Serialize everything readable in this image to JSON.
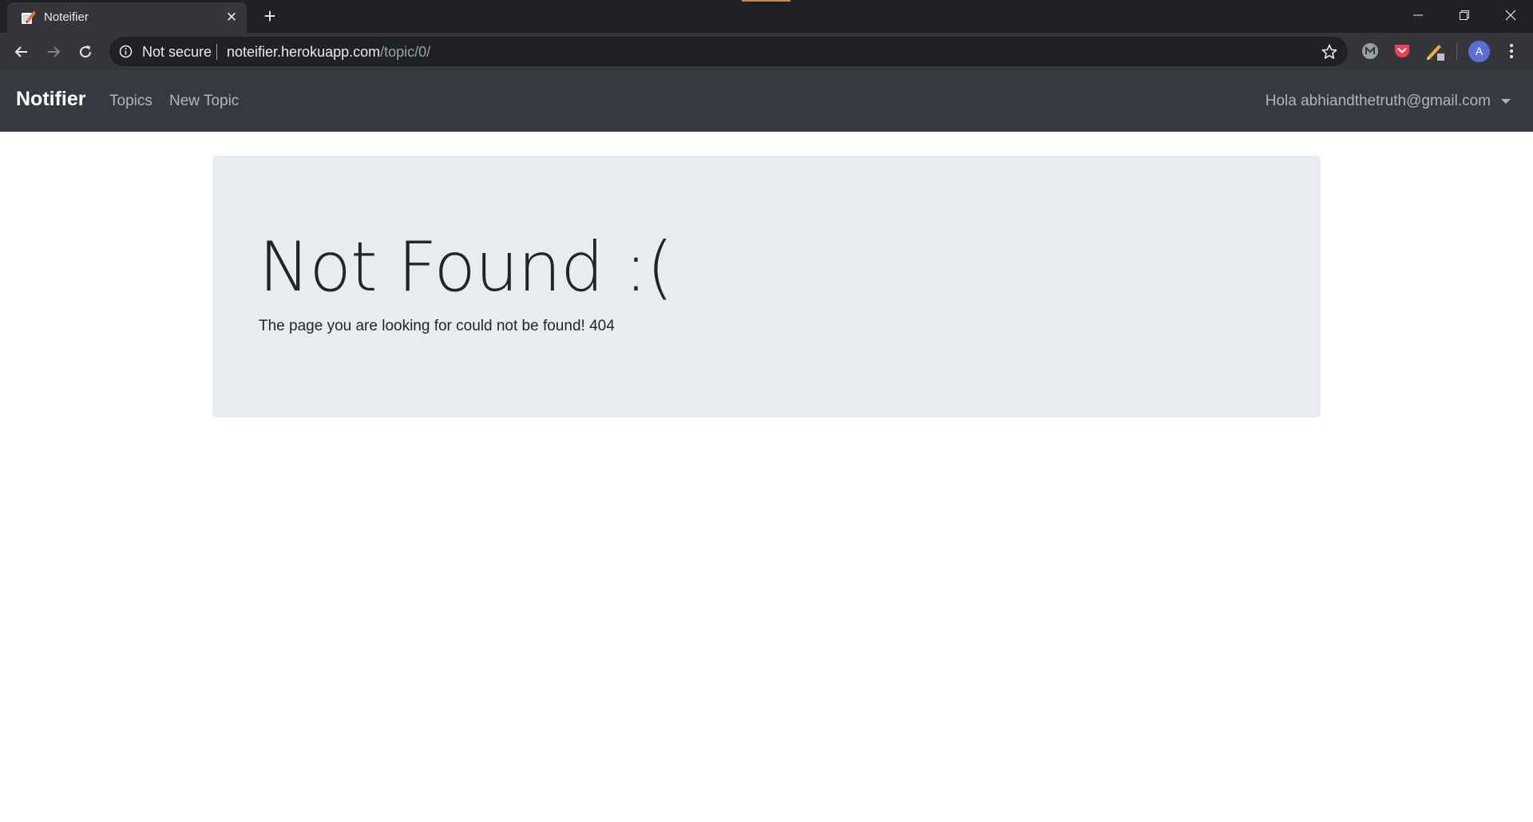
{
  "browser": {
    "tab": {
      "title": "Noteifier",
      "favicon": "notepad-pen-icon"
    },
    "address_bar": {
      "security_label": "Not secure",
      "url_host": "noteifier.herokuapp.com",
      "url_path": "/topic/0/"
    },
    "extension_icons": [
      "m-extension-icon",
      "pocket-icon",
      "pen-extension-icon"
    ],
    "profile_initial": "A",
    "colors": {
      "tabstrip": "#202124",
      "toolbar": "#35363a",
      "avatar": "#5b6fd6",
      "pocket": "#ef4056"
    }
  },
  "navbar": {
    "brand": "Notifier",
    "links": [
      "Topics",
      "New Topic"
    ],
    "user_menu": "Hola abhiandthetruth@gmail.com",
    "background": "#343a40"
  },
  "jumbotron": {
    "title": "Not Found :(",
    "message": "The page you are looking for could not be found! 404",
    "background": "#e9ecef"
  }
}
